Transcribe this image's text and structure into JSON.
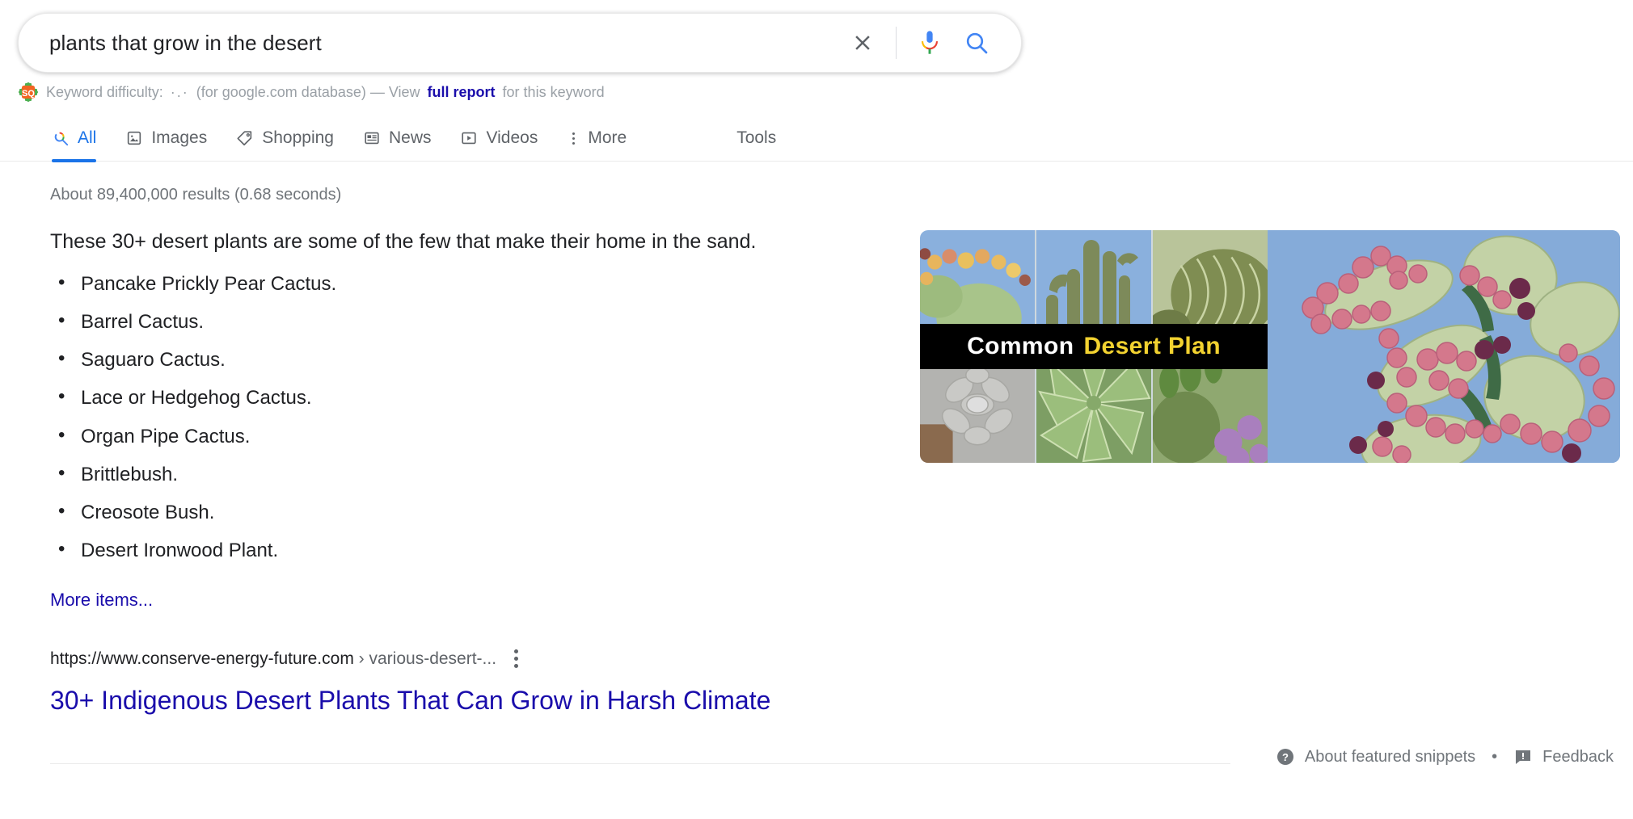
{
  "search": {
    "query": "plants that grow in the desert",
    "placeholder": "Search",
    "clear_icon": "close-icon",
    "voice_icon": "microphone-icon",
    "search_icon": "search-icon"
  },
  "seoquake": {
    "badge": "seoquake-icon",
    "label_prefix": "Keyword difficulty:",
    "value": "",
    "database_note": "(for google.com database) — View",
    "link": "full report",
    "suffix": "for this keyword"
  },
  "nav": {
    "tabs": [
      {
        "label": "All",
        "icon": "google-search-icon",
        "active": true
      },
      {
        "label": "Images",
        "icon": "image-icon",
        "active": false
      },
      {
        "label": "Shopping",
        "icon": "tag-icon",
        "active": false
      },
      {
        "label": "News",
        "icon": "newspaper-icon",
        "active": false
      },
      {
        "label": "Videos",
        "icon": "video-play-icon",
        "active": false
      },
      {
        "label": "More",
        "icon": "vertical-dots-icon",
        "active": false
      }
    ],
    "tools_label": "Tools"
  },
  "result_stats": "About 89,400,000 results (0.68 seconds)",
  "featured_snippet": {
    "lead": "These 30+ desert plants are some of the few that make their home in the sand.",
    "items": [
      "Pancake Prickly Pear Cactus.",
      "Barrel Cactus.",
      "Saguaro Cactus.",
      "Lace or Hedgehog Cactus.",
      "Organ Pipe Cactus.",
      "Brittlebush.",
      "Creosote Bush.",
      "Desert Ironwood Plant."
    ],
    "more_items_label": "More items...",
    "image": {
      "banner_word_1": "Common",
      "banner_word_2": "Desert Plan",
      "alt": "Collage of common desert plants"
    }
  },
  "organic_result": {
    "url_domain": "https://www.conserve-energy-future.com",
    "url_path": "› various-desert-...",
    "kebab": "more-options-icon",
    "title": "30+ Indigenous Desert Plants That Can Grow in Harsh Climate"
  },
  "snippet_footer": {
    "about_icon": "help-circle-icon",
    "about_label": "About featured snippets",
    "separator": "•",
    "feedback_icon": "feedback-icon",
    "feedback_label": "Feedback"
  },
  "colors": {
    "link_blue": "#1a0dab",
    "tab_blue": "#1a73e8",
    "text_primary": "#202124",
    "text_secondary": "#70757a",
    "banner_yellow": "#f2d230"
  }
}
